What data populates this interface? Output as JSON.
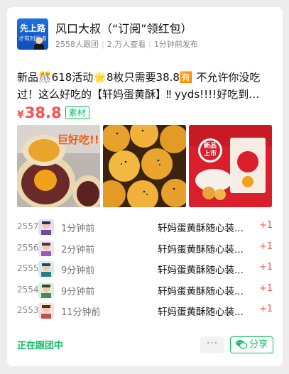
{
  "header": {
    "avatar_line1": "先上路",
    "avatar_line2": "才有时行者",
    "account_name": "风口大叔（“订阅”领红包）",
    "followers": "2558人跟团",
    "views": "2.万人查看",
    "posted": "1分钟前发布"
  },
  "post": {
    "title": "新品🎊618活动🌟8枚只需要38.8🈶 不允许你没吃过！这么好吃的【轩妈蛋黄酥】‼ yyds!!!!好吃到…",
    "price_symbol": "¥",
    "price": "38.8",
    "tag": "素材"
  },
  "images": [
    {
      "name": "mooncake-cross-section",
      "caption": "巨好吃!!!"
    },
    {
      "name": "egg-yolk-pastries"
    },
    {
      "name": "product-package",
      "badge": "新品上市"
    }
  ],
  "orders": [
    {
      "seq": "2557",
      "time": "1分钟前",
      "item": "轩妈蛋黄酥随心装...",
      "qty": "+1"
    },
    {
      "seq": "2556",
      "time": "2分钟前",
      "item": "轩妈蛋黄酥随心装...",
      "qty": "+1"
    },
    {
      "seq": "2555",
      "time": "9分钟前",
      "item": "轩妈蛋黄酥随心装...",
      "qty": "+1"
    },
    {
      "seq": "2554",
      "time": "9分钟前",
      "item": "轩妈蛋黄酥随心装...",
      "qty": "+1"
    },
    {
      "seq": "2553",
      "time": "11分钟前",
      "item": "轩妈蛋黄酥随心装...",
      "qty": "+1"
    }
  ],
  "footer": {
    "following": "正在跟团中",
    "more": "···",
    "share": "分享"
  },
  "colors": {
    "accent_green": "#07c160",
    "price_red": "#fa5151"
  }
}
